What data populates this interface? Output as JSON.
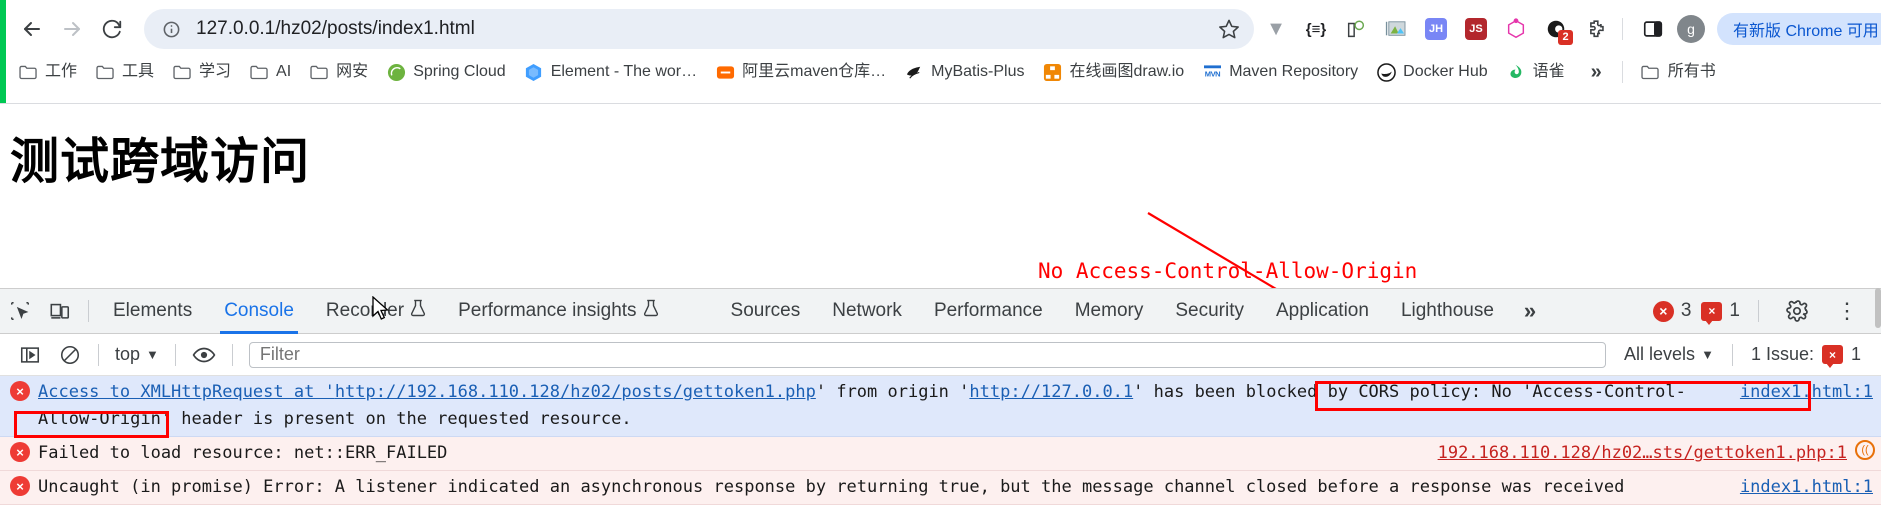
{
  "browser": {
    "nav": {
      "back_label": "Back",
      "forward_label": "Forward",
      "reload_label": "Reload"
    },
    "omnibox": {
      "url": "127.0.0.1/hz02/posts/index1.html",
      "site_info_icon": "info-circle-icon",
      "bookmark_icon": "star-icon"
    },
    "extensions": [
      {
        "name": "vue-devtools-icon",
        "glyph": "▼",
        "color": "#9aa0a6",
        "kind": "glyph"
      },
      {
        "name": "json-viewer-icon",
        "glyph": "{≡}",
        "color": "#202124",
        "kind": "glyph"
      },
      {
        "name": "wappalyzer-icon",
        "glyph": "⚇",
        "color": "#3c4043",
        "kind": "glyph"
      },
      {
        "name": "screenshot-icon",
        "glyph": "⛰",
        "color": "#5f6368",
        "kind": "glyph"
      },
      {
        "name": "jh-extension-icon",
        "glyph": "JH",
        "color": "#7986f5",
        "kind": "square"
      },
      {
        "name": "js-extension-icon",
        "glyph": "JS",
        "color": "#b3272d",
        "kind": "square"
      },
      {
        "name": "graphql-extension-icon",
        "glyph": "⬡",
        "color": "#e535ab",
        "kind": "glyph"
      },
      {
        "name": "tampermonkey-icon",
        "glyph": "●",
        "color": "#1a1a1a",
        "kind": "glyph",
        "badge": "2"
      },
      {
        "name": "puzzle-extensions-icon",
        "glyph": "⬚",
        "color": "#3c4043",
        "kind": "glyph"
      }
    ],
    "side_panel_icon": "side-panel-icon",
    "profile": {
      "avatar_letter": "g"
    },
    "update_chip": "有新版 Chrome 可用",
    "menu_icon": "three-dot-menu-icon"
  },
  "bookmarks": {
    "items": [
      {
        "label": "工作",
        "icon": "folder-icon",
        "glyph": "🗀",
        "color": "#5f6368"
      },
      {
        "label": "工具",
        "icon": "folder-icon",
        "glyph": "🗀",
        "color": "#5f6368"
      },
      {
        "label": "学习",
        "icon": "folder-icon",
        "glyph": "🗀",
        "color": "#5f6368"
      },
      {
        "label": "AI",
        "icon": "folder-icon",
        "glyph": "🗀",
        "color": "#5f6368"
      },
      {
        "label": "网安",
        "icon": "folder-icon",
        "glyph": "🗀",
        "color": "#5f6368"
      },
      {
        "label": "Spring Cloud",
        "icon": "spring-icon",
        "glyph": "◕",
        "color": "#6db33f"
      },
      {
        "label": "Element - The wor…",
        "icon": "element-ui-icon",
        "glyph": "⬡",
        "color": "#409eff"
      },
      {
        "label": "阿里云maven仓库…",
        "icon": "aliyun-icon",
        "glyph": "⊖",
        "color": "#ff6a00"
      },
      {
        "label": "MyBatis-Plus",
        "icon": "mybatis-icon",
        "glyph": "🐦",
        "color": "#1a1a1a"
      },
      {
        "label": "在线画图draw.io",
        "icon": "drawio-icon",
        "glyph": "▲",
        "color": "#f08705"
      },
      {
        "label": "Maven Repository",
        "icon": "maven-icon",
        "glyph": "MVN",
        "color": "#1f6fd0"
      },
      {
        "label": "Docker Hub",
        "icon": "docker-icon",
        "glyph": "◉",
        "color": "#1d63ed"
      },
      {
        "label": "语雀",
        "icon": "yuque-icon",
        "glyph": "◖",
        "color": "#25b864"
      }
    ],
    "overflow_label": "»",
    "all_bookmarks": {
      "label": "所有书",
      "icon": "folder-icon",
      "glyph": "🗀"
    }
  },
  "page": {
    "title": "测试跨域访问",
    "annotation": "No Access-Control-Allow-Origin",
    "annotation_color": "#ff0000"
  },
  "devtools": {
    "left_icons": [
      {
        "name": "inspect-element-icon"
      },
      {
        "name": "device-toolbar-icon"
      }
    ],
    "tabs": [
      {
        "label": "Elements",
        "active": false,
        "beaker": false
      },
      {
        "label": "Console",
        "active": true,
        "beaker": false
      },
      {
        "label": "Recorder",
        "active": false,
        "beaker": true
      },
      {
        "label": "Performance insights",
        "active": false,
        "beaker": true
      },
      {
        "label": "Sources",
        "active": false,
        "beaker": false
      },
      {
        "label": "Network",
        "active": false,
        "beaker": false
      },
      {
        "label": "Performance",
        "active": false,
        "beaker": false
      },
      {
        "label": "Memory",
        "active": false,
        "beaker": false
      },
      {
        "label": "Security",
        "active": false,
        "beaker": false
      },
      {
        "label": "Application",
        "active": false,
        "beaker": false
      },
      {
        "label": "Lighthouse",
        "active": false,
        "beaker": false
      }
    ],
    "more_tabs_label": "»",
    "error_count": "3",
    "warning_count": "1",
    "settings_icon": "gear-icon",
    "menu_icon": "three-dot-menu-icon",
    "console_toolbar": {
      "sidebar_icon": "console-sidebar-icon",
      "clear_icon": "clear-console-icon",
      "context": "top",
      "eye_icon": "live-expression-eye-icon",
      "filter_placeholder": "Filter",
      "filter_value": "",
      "levels": "All levels",
      "issues_label": "1 Issue:",
      "issues_count": "1"
    },
    "messages": [
      {
        "level": "error",
        "tone": "blue",
        "icon": "error-circle-icon",
        "parts": [
          {
            "t": "Access to XMLHttpRequest at '",
            "k": "text"
          },
          {
            "t": "http://192.168.110.128/hz02/posts/gettoken1.php",
            "k": "link"
          },
          {
            "t": "' from origin '",
            "k": "text"
          },
          {
            "t": "http://127.0.0.1",
            "k": "link"
          },
          {
            "t": "' has been blocked by CORS policy: No 'Access-Control-Allow-Origin' header is present on the requested resource.",
            "k": "text"
          }
        ],
        "source": "index1.html:1"
      },
      {
        "level": "error",
        "tone": "pink",
        "icon": "error-circle-icon",
        "parts": [
          {
            "t": "Failed to load resource: net::ERR_FAILED",
            "k": "text"
          }
        ],
        "source": "192.168.110.128/hz02…sts/gettoken1.php:1",
        "network_badge": "network-icon"
      },
      {
        "level": "error",
        "tone": "pink",
        "icon": "error-circle-icon",
        "parts": [
          {
            "t": "Uncaught (in promise) Error: A listener indicated an asynchronous response by returning true, but the message channel closed before a response was received",
            "k": "text"
          }
        ],
        "source": "index1.html:1"
      }
    ],
    "highlights": [
      {
        "name": "cors-policy-highlight",
        "text": "by CORS policy: No 'Access-Control-"
      },
      {
        "name": "allow-origin-highlight",
        "text": "Allow-Origin'"
      }
    ]
  }
}
